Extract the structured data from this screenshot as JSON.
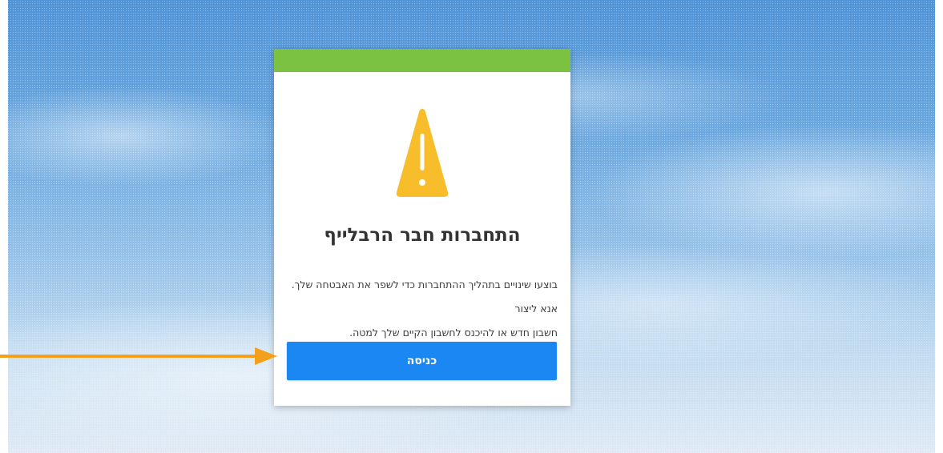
{
  "dialog": {
    "title": "התחברות חבר הרבלייף",
    "message_line1": "בוצעו שינויים בתהליך ההתחברות כדי לשפר את האבטחה שלך. אנא ליצור",
    "message_line2": "חשבון חדש או להיכנס לחשבון הקיים שלך למטה.",
    "login_button_label": "כניסה",
    "warning_icon": "warning-triangle-icon",
    "header_bar_color": "#7bc142",
    "button_color": "#1b87f2",
    "warning_color": "#f8bd2b"
  },
  "annotation": {
    "arrow_icon": "arrow-right-icon",
    "arrow_color": "#f3a01d"
  }
}
